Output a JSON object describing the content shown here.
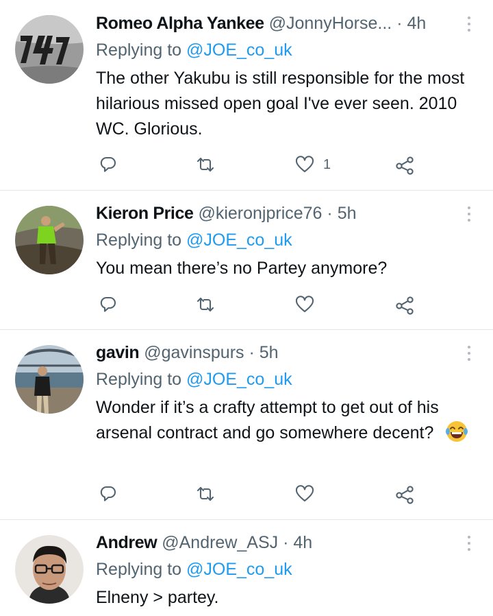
{
  "replying_label": "Replying to",
  "tweets": [
    {
      "name": "Romeo Alpha Yankee",
      "handle": "@JonnyHorse...",
      "time": "4h",
      "reply_to": "@JOE_co_uk",
      "text": "The other Yakubu is still responsible for the most hilarious missed open goal I've ever seen. 2010 WC. Glorious.",
      "likes": "1"
    },
    {
      "name": "Kieron Price",
      "handle": "@kieronjprice76",
      "time": "5h",
      "reply_to": "@JOE_co_uk",
      "text": "You mean there’s no Partey anymore?",
      "likes": ""
    },
    {
      "name": "gavin",
      "handle": "@gavinspurs",
      "time": "5h",
      "reply_to": "@JOE_co_uk",
      "text": "Wonder if it’s a crafty attempt to get out of his arsenal contract and go somewhere decent?",
      "likes": ""
    },
    {
      "name": "Andrew",
      "handle": "@Andrew_ASJ",
      "time": "4h",
      "reply_to": "@JOE_co_uk",
      "text": "Elneny > partey.",
      "likes": ""
    }
  ],
  "dot_separator": "·",
  "colors": {
    "link": "#1d9bf0",
    "muted": "#536471",
    "text": "#0f1419",
    "divider": "#e5e5e5"
  },
  "icons": [
    "reply-icon",
    "retweet-icon",
    "like-icon",
    "share-icon",
    "more-icon",
    "laughing-emoji-icon"
  ]
}
